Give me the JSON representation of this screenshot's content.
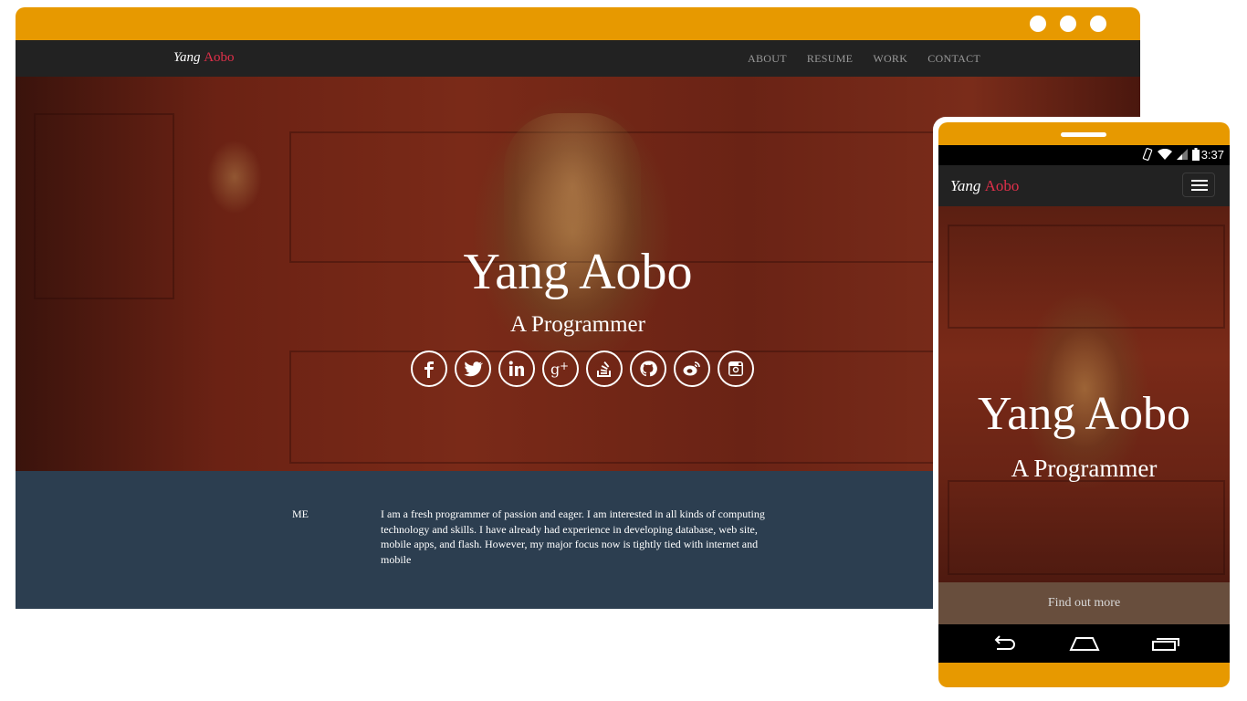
{
  "colors": {
    "frame": "#e79900",
    "navbar": "#222222",
    "brand_accent": "#e0304a",
    "about_bg": "#2c3e50"
  },
  "desktop": {
    "brand": {
      "first": "Yang",
      "last": "Aobo"
    },
    "nav": [
      "ABOUT",
      "RESUME",
      "WORK",
      "CONTACT"
    ],
    "hero": {
      "title": "Yang Aobo",
      "subtitle": "A Programmer",
      "socials": [
        "facebook-icon",
        "twitter-icon",
        "linkedin-icon",
        "google-plus-icon",
        "stackoverflow-icon",
        "github-icon",
        "weibo-icon",
        "instagram-icon"
      ]
    },
    "about": {
      "label": "ME",
      "text": "I am a fresh programmer of passion and eager. I am interested in all kinds of computing technology and skills. I have already had experience in developing database, web site, mobile apps, and flash. However, my major focus now is tightly tied with internet and mobile"
    }
  },
  "mobile": {
    "status": {
      "time": "3:37"
    },
    "brand": {
      "first": "Yang",
      "last": "Aobo"
    },
    "hero": {
      "title": "Yang Aobo",
      "subtitle": "A Programmer"
    },
    "cta": "Find out more"
  }
}
